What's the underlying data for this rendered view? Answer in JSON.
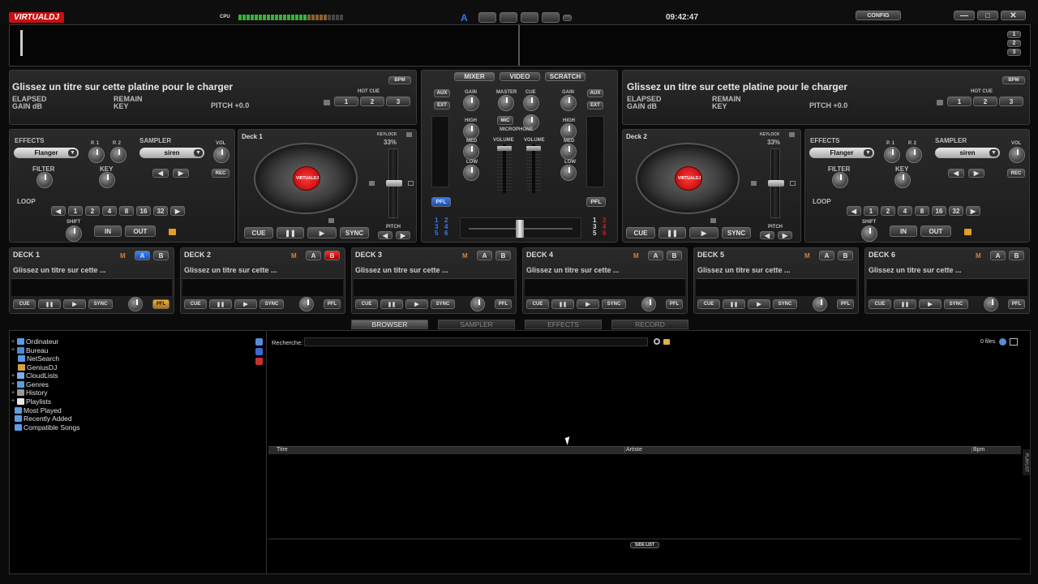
{
  "app": {
    "logo": "VIRTUALDJ",
    "cpu_label": "CPU",
    "clock": "09:42:47",
    "config_label": "CONFIG",
    "layout_indicator": "A",
    "deck_selector": [
      "1",
      "2",
      "3"
    ]
  },
  "colors": {
    "accent_red": "#e01818",
    "accent_blue": "#2a6ad8",
    "pfl_orange": "#e0a020",
    "m_orange": "#e08030"
  },
  "top_deck": {
    "left": {
      "message": "Glissez un titre sur cette platine pour le charger",
      "elapsed": "ELAPSED",
      "remain": "REMAIN",
      "gain": "GAIN dB",
      "key": "KEY",
      "pitch": "PITCH +0.0",
      "bpm": "BPM",
      "hot_cue": "HOT CUE",
      "hot_cues": [
        "1",
        "2",
        "3"
      ]
    },
    "right": {
      "message": "Glissez un titre sur cette platine pour le charger",
      "elapsed": "ELAPSED",
      "remain": "REMAIN",
      "gain": "GAIN dB",
      "key": "KEY",
      "pitch": "PITCH +0.0",
      "bpm": "BPM",
      "hot_cue": "HOT CUE",
      "hot_cues": [
        "1",
        "2",
        "3"
      ]
    }
  },
  "effects_panel": {
    "effects": "EFFECTS",
    "effect_name": "Flanger",
    "p1": "P. 1",
    "p2": "P. 2",
    "sampler": "SAMPLER",
    "sample_name": "siren",
    "vol": "VOL",
    "filter": "FILTER",
    "key": "KEY",
    "rec": "REC",
    "loop": "LOOP",
    "loop_sizes": [
      "1",
      "2",
      "4",
      "8",
      "16",
      "32"
    ],
    "shift": "SHIFT",
    "in": "IN",
    "out": "OUT"
  },
  "deck_view": {
    "left": {
      "name": "Deck 1",
      "keylock": "KEYLOCK",
      "pitch_percent": "33%",
      "pitch": "PITCH",
      "cue": "CUE",
      "sync": "SYNC",
      "logo": "VIRTUALDJ"
    },
    "right": {
      "name": "Deck 2",
      "keylock": "KEYLOCK",
      "pitch_percent": "33%",
      "pitch": "PITCH",
      "cue": "CUE",
      "sync": "SYNC",
      "logo": "VIRTUALDJ"
    }
  },
  "mixer": {
    "tabs": [
      "MIXER",
      "VIDEO",
      "SCRATCH"
    ],
    "aux": "AUX",
    "ext": "EXT",
    "gain": "GAIN",
    "master": "MASTER",
    "cue": "CUE",
    "high": "HIGH",
    "med": "MED",
    "low": "LOW",
    "mic": "MIC",
    "microphone": "MICROPHONE",
    "volume": "VOLUME",
    "pfl": "PFL",
    "deck_nums_left": [
      "1",
      "2",
      "3",
      "4",
      "5",
      "6"
    ],
    "deck_nums_right": [
      "1",
      "2",
      "3",
      "4",
      "5",
      "6"
    ]
  },
  "deck_slots": [
    {
      "title": "DECK 1",
      "m": "M",
      "a": "A",
      "b": "B",
      "message": "Glissez un titre sur cette ...",
      "cue": "CUE",
      "sync": "SYNC",
      "pfl": "PFL"
    },
    {
      "title": "DECK 2",
      "m": "M",
      "a": "A",
      "b": "B",
      "message": "Glissez un titre sur cette ...",
      "cue": "CUE",
      "sync": "SYNC",
      "pfl": "PFL"
    },
    {
      "title": "DECK 3",
      "m": "M",
      "a": "A",
      "b": "B",
      "message": "Glissez un titre sur cette ...",
      "cue": "CUE",
      "sync": "SYNC",
      "pfl": "PFL"
    },
    {
      "title": "DECK 4",
      "m": "M",
      "a": "A",
      "b": "B",
      "message": "Glissez un titre sur cette ...",
      "cue": "CUE",
      "sync": "SYNC",
      "pfl": "PFL"
    },
    {
      "title": "DECK 5",
      "m": "M",
      "a": "A",
      "b": "B",
      "message": "Glissez un titre sur cette ...",
      "cue": "CUE",
      "sync": "SYNC",
      "pfl": "PFL"
    },
    {
      "title": "DECK 6",
      "m": "M",
      "a": "A",
      "b": "B",
      "message": "Glissez un titre sur cette ...",
      "cue": "CUE",
      "sync": "SYNC",
      "pfl": "PFL"
    }
  ],
  "browser_tabs": [
    "BROWSER",
    "SAMPLER",
    "EFFECTS",
    "RECORD"
  ],
  "tree": [
    {
      "label": "Ordinateur",
      "icon": "computer-icon"
    },
    {
      "label": "Bureau",
      "icon": "desktop-icon"
    },
    {
      "label": "NetSearch",
      "icon": "netsearch-icon"
    },
    {
      "label": "GeniusDJ",
      "icon": "geniusdj-icon"
    },
    {
      "label": "CloudLists",
      "icon": "cloud-icon"
    },
    {
      "label": "Genres",
      "icon": "genres-icon"
    },
    {
      "label": "History",
      "icon": "history-icon"
    },
    {
      "label": "Playlists",
      "icon": "playlist-icon"
    },
    {
      "label": "Most Played",
      "icon": "folder-icon"
    },
    {
      "label": "Recently Added",
      "icon": "folder-icon"
    },
    {
      "label": "Compatible Songs",
      "icon": "folder-icon"
    }
  ],
  "browser": {
    "search_label": "Recherche:",
    "search_value": "",
    "files_count": "0 files",
    "columns": [
      "Titre",
      "Artiste",
      "Bpm"
    ],
    "side_list": "SIDE LIST",
    "playlist_tab": "PLAYLIST"
  }
}
